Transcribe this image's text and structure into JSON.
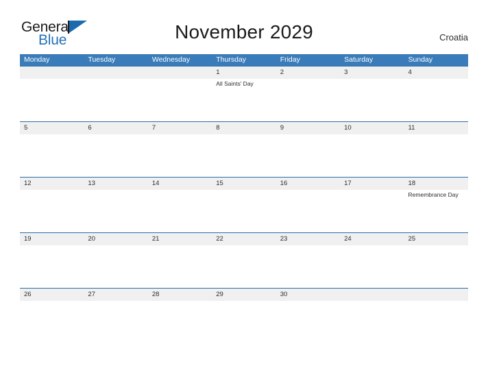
{
  "brand": {
    "name_top": "General",
    "name_bottom": "Blue",
    "accent_color": "#2272b8",
    "flag_icon": "flag-triangle-icon"
  },
  "header": {
    "title": "November 2029",
    "country": "Croatia"
  },
  "colors": {
    "header_blue": "#3a7cb9",
    "row_divider_blue": "#2d6ca5",
    "day_band_gray": "#f0f0f0",
    "text": "#2b2b2b"
  },
  "calendar": {
    "month": "November",
    "year": "2029",
    "weekday_headers": [
      "Monday",
      "Tuesday",
      "Wednesday",
      "Thursday",
      "Friday",
      "Saturday",
      "Sunday"
    ],
    "weeks": [
      {
        "days": [
          {
            "num": "",
            "event": ""
          },
          {
            "num": "",
            "event": ""
          },
          {
            "num": "",
            "event": ""
          },
          {
            "num": "1",
            "event": "All Saints' Day"
          },
          {
            "num": "2",
            "event": ""
          },
          {
            "num": "3",
            "event": ""
          },
          {
            "num": "4",
            "event": ""
          }
        ]
      },
      {
        "days": [
          {
            "num": "5",
            "event": ""
          },
          {
            "num": "6",
            "event": ""
          },
          {
            "num": "7",
            "event": ""
          },
          {
            "num": "8",
            "event": ""
          },
          {
            "num": "9",
            "event": ""
          },
          {
            "num": "10",
            "event": ""
          },
          {
            "num": "11",
            "event": ""
          }
        ]
      },
      {
        "days": [
          {
            "num": "12",
            "event": ""
          },
          {
            "num": "13",
            "event": ""
          },
          {
            "num": "14",
            "event": ""
          },
          {
            "num": "15",
            "event": ""
          },
          {
            "num": "16",
            "event": ""
          },
          {
            "num": "17",
            "event": ""
          },
          {
            "num": "18",
            "event": "Remembrance Day"
          }
        ]
      },
      {
        "days": [
          {
            "num": "19",
            "event": ""
          },
          {
            "num": "20",
            "event": ""
          },
          {
            "num": "21",
            "event": ""
          },
          {
            "num": "22",
            "event": ""
          },
          {
            "num": "23",
            "event": ""
          },
          {
            "num": "24",
            "event": ""
          },
          {
            "num": "25",
            "event": ""
          }
        ]
      },
      {
        "days": [
          {
            "num": "26",
            "event": ""
          },
          {
            "num": "27",
            "event": ""
          },
          {
            "num": "28",
            "event": ""
          },
          {
            "num": "29",
            "event": ""
          },
          {
            "num": "30",
            "event": ""
          },
          {
            "num": "",
            "event": ""
          },
          {
            "num": "",
            "event": ""
          }
        ]
      }
    ]
  }
}
